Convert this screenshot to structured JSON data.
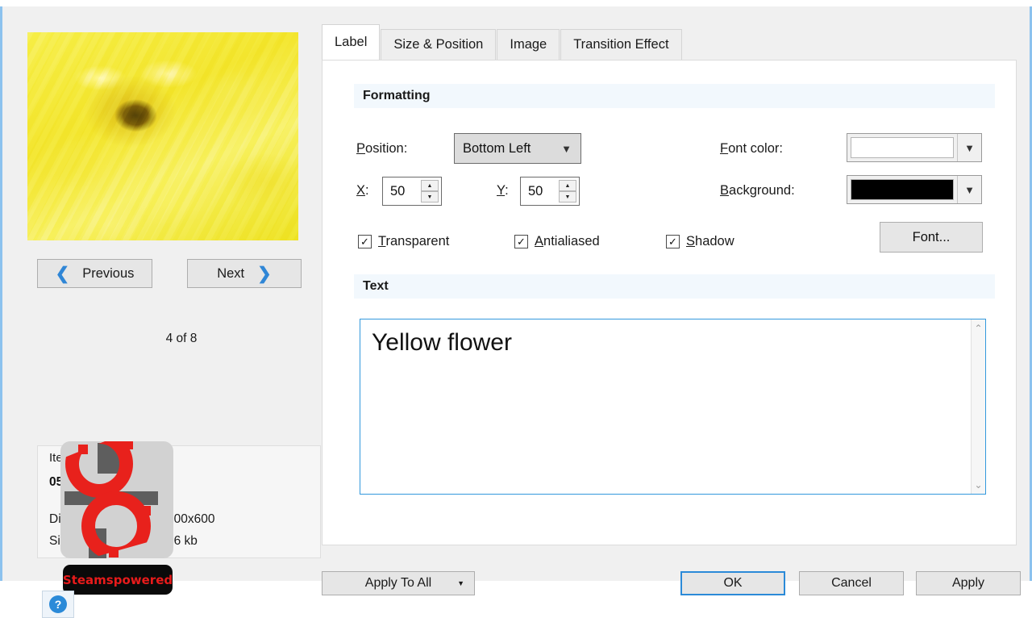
{
  "left": {
    "preview_alt": "yellow-flower-preview",
    "previous_label": "Previous",
    "next_label": "Next",
    "prev_icon": "chevron-left-icon",
    "next_icon": "chevron-right-icon",
    "counter": "4 of 8",
    "properties": {
      "title": "Item Properties",
      "filename": "05...jpg",
      "dimensions_label": "Dimensions",
      "dimensions_value": "800x600",
      "size_label": "Size",
      "size_value": "76 kb"
    },
    "watermark_badge": "Steamspowered",
    "help_glyph": "?"
  },
  "tabs": [
    {
      "label": "Label",
      "active": true
    },
    {
      "label": "Size & Position",
      "active": false
    },
    {
      "label": "Image",
      "active": false
    },
    {
      "label": "Transition Effect",
      "active": false
    }
  ],
  "formatting": {
    "header": "Formatting",
    "position_label": "Position:",
    "position_value": "Bottom Left",
    "x_label": "X:",
    "x_value": "50",
    "y_label": "Y:",
    "y_value": "50",
    "transparent_label": "Transparent",
    "transparent_checked": "✓",
    "antialiased_label": "Antialiased",
    "antialiased_checked": "✓",
    "shadow_label": "Shadow",
    "shadow_checked": "✓",
    "font_color_label": "Font color:",
    "font_color_value": "#ffffff",
    "background_label": "Background:",
    "background_value": "#000000",
    "font_button": "Font...",
    "dropdown_arrow": "⌄",
    "spin_up": "▲",
    "spin_down": "▼"
  },
  "text_section": {
    "header": "Text",
    "value": "Yellow flower",
    "scroll_up": "⌃",
    "scroll_down": "⌄"
  },
  "footer": {
    "apply_to_all": "Apply To All",
    "apply_to_all_arrow": "▼",
    "ok": "OK",
    "cancel": "Cancel",
    "apply": "Apply"
  },
  "colors": {
    "accent": "#2b8ad8",
    "section_bg": "#f2f8fd",
    "dialog_bg": "#f0f0f0",
    "window_border": "#8cc2ee"
  }
}
